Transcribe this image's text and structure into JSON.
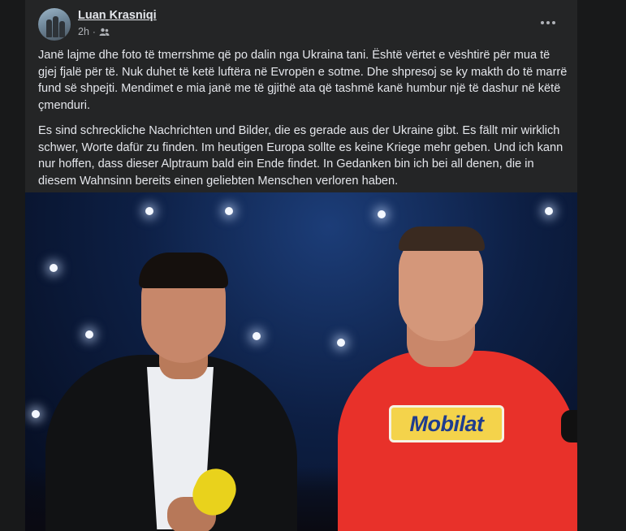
{
  "post": {
    "author": "Luan Krasniqi",
    "time": "2h",
    "separator": "·",
    "audience_icon": "friends-icon",
    "more_icon": "more-horizontal-icon",
    "paragraphs": [
      "Janë lajme dhe foto të tmerrshme që po dalin nga Ukraina tani. Është vërtet e vështirë për mua të gjej fjalë për të. Nuk duhet të ketë luftëra në Evropën e sotme. Dhe shpresoj se ky makth do të marrë fund së shpejti. Mendimet e mia janë me të gjithë ata që tashmë kanë humbur një të dashur në këtë çmenduri.",
      "Es sind schreckliche Nachrichten und Bilder, die es gerade aus der Ukraine gibt. Es fällt mir wirklich schwer, Worte dafür zu finden. Im heutigen Europa sollte es keine Kriege mehr geben. Und ich kann nur hoffen, dass dieser Alptraum bald ein Ende findet. In Gedanken bin ich bei all denen, die in diesem Wahnsinn bereits einen geliebten Menschen verloren haben."
    ],
    "photo_shirt_logo": "Mobilat"
  },
  "colors": {
    "page_bg": "#18191a",
    "card_bg": "#242526",
    "text_primary": "#e4e6eb",
    "text_secondary": "#b0b3b8",
    "shirt_red": "#e8312a",
    "logo_yellow": "#f4d34b",
    "logo_blue": "#1f3c8e"
  }
}
